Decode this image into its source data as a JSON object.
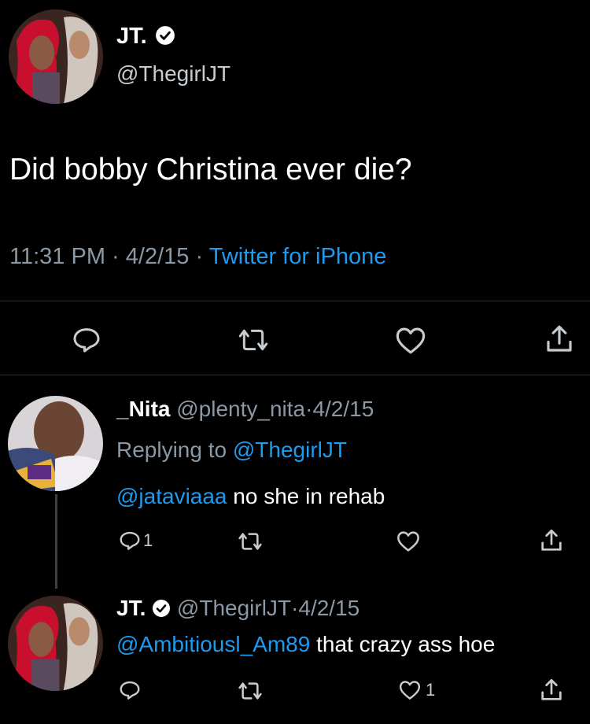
{
  "main_tweet": {
    "display_name": "JT.",
    "handle": "@ThegirlJT",
    "text": "Did bobby Christina ever die?",
    "time": "11:31 PM",
    "sep1": "·",
    "date": "4/2/15",
    "sep2": "·",
    "source": "Twitter for iPhone"
  },
  "reply1": {
    "display_name": "_Nita",
    "handle": "@plenty_nita",
    "sep": "·",
    "date": "4/2/15",
    "replying_prefix": "Replying to",
    "replying_handle": "@ThegirlJT",
    "mention": "@jataviaaa",
    "text": " no she in rehab",
    "reply_count": "1",
    "like_count": ""
  },
  "reply2": {
    "display_name": "JT.",
    "handle": "@ThegirlJT",
    "sep": "·",
    "date": "4/2/15",
    "mention": "@Ambitiousl_Am89",
    "text": " that crazy ass hoe",
    "reply_count": "",
    "like_count": "1"
  },
  "colors": {
    "background": "#000000",
    "text": "#ffffff",
    "muted": "#8b98a5",
    "link": "#1d9bf0",
    "divider": "#2f3336"
  },
  "icons": [
    "verified-badge-icon",
    "reply-icon",
    "retweet-icon",
    "like-icon",
    "share-icon"
  ]
}
